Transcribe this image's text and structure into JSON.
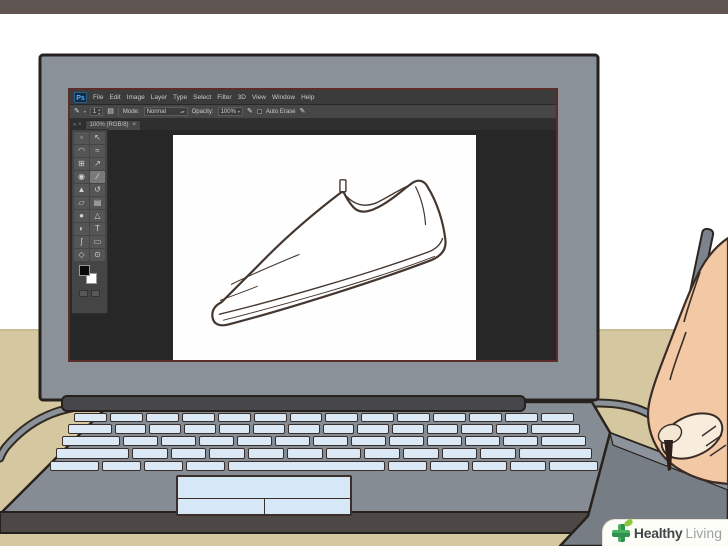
{
  "scene": {
    "description_colors": {
      "wall": "#ffffff",
      "top_trim": "#5e5452",
      "desk": "#d5c8a1",
      "laptop_gray": "#8b9199",
      "key_blue": "#dbe9f6",
      "outline": "#2a2320",
      "skin": "#f2c9a4",
      "fingertip": "#f8ecdc",
      "stylus_gray": "#7d838c",
      "tablet_gray": "#777d85",
      "ps_dark": "#272727",
      "ps_window_border": "#5a2d28",
      "canvas_white": "#fefefe",
      "shoe_line": "#44372f",
      "logo_green": "#2f9150",
      "logo_leaf_green": "#8dc63f"
    }
  },
  "photoshop": {
    "logo": "Ps",
    "menu_items": [
      "File",
      "Edit",
      "Image",
      "Layer",
      "Type",
      "Select",
      "Filter",
      "3D",
      "View",
      "Window",
      "Help"
    ],
    "options_bar": {
      "tool_icon": "✎",
      "tool_dropdown": "▾",
      "brush_size_value": "1",
      "stepper_up": "▴",
      "stepper_down": "▾",
      "panel_toggle_icon": "▤",
      "mode_label": "Mode:",
      "mode_value": "Normal",
      "mode_dropdown": "▴▾",
      "opacity_label": "Opacity:",
      "opacity_value": "100%",
      "opacity_dropdown": "▾",
      "airbrush_icon": "✎",
      "auto_erase_label": "Auto Erase",
      "auto_erase_checked": false,
      "smoothing_icon": "✎"
    },
    "document_tab": {
      "prefix": "« ×",
      "label": "100% (RGB/8)",
      "close": "×"
    },
    "tools": [
      {
        "name": "rect-marquee-tool",
        "glyph": "▫",
        "active": false
      },
      {
        "name": "move-tool",
        "glyph": "↖",
        "active": false
      },
      {
        "name": "lasso-tool",
        "glyph": "◠",
        "active": false
      },
      {
        "name": "quick-selection-tool",
        "glyph": "≈",
        "active": false
      },
      {
        "name": "crop-tool",
        "glyph": "⊞",
        "active": false
      },
      {
        "name": "eyedropper-tool",
        "glyph": "↗",
        "active": false
      },
      {
        "name": "healing-brush-tool",
        "glyph": "◉",
        "active": false
      },
      {
        "name": "pencil-tool",
        "glyph": "∕",
        "active": true
      },
      {
        "name": "clone-stamp-tool",
        "glyph": "▲",
        "active": false
      },
      {
        "name": "history-brush-tool",
        "glyph": "↺",
        "active": false
      },
      {
        "name": "eraser-tool",
        "glyph": "▱",
        "active": false
      },
      {
        "name": "gradient-tool",
        "glyph": "▤",
        "active": false
      },
      {
        "name": "blur-tool",
        "glyph": "●",
        "active": false
      },
      {
        "name": "sharpen-tool",
        "glyph": "△",
        "active": false
      },
      {
        "name": "dodge-tool",
        "glyph": "◐",
        "active": false
      },
      {
        "name": "type-tool",
        "glyph": "T",
        "active": false
      },
      {
        "name": "pen-tool",
        "glyph": "ʃ",
        "active": false
      },
      {
        "name": "shape-tool",
        "glyph": "▭",
        "active": false
      },
      {
        "name": "hand-tool",
        "glyph": "◇",
        "active": false
      },
      {
        "name": "zoom-tool",
        "glyph": "⊙",
        "active": false
      }
    ],
    "canvas_subject": "line drawing of a dress shoe"
  },
  "watermark": {
    "brand_bold": "Healthy",
    "brand_light": "Living"
  }
}
